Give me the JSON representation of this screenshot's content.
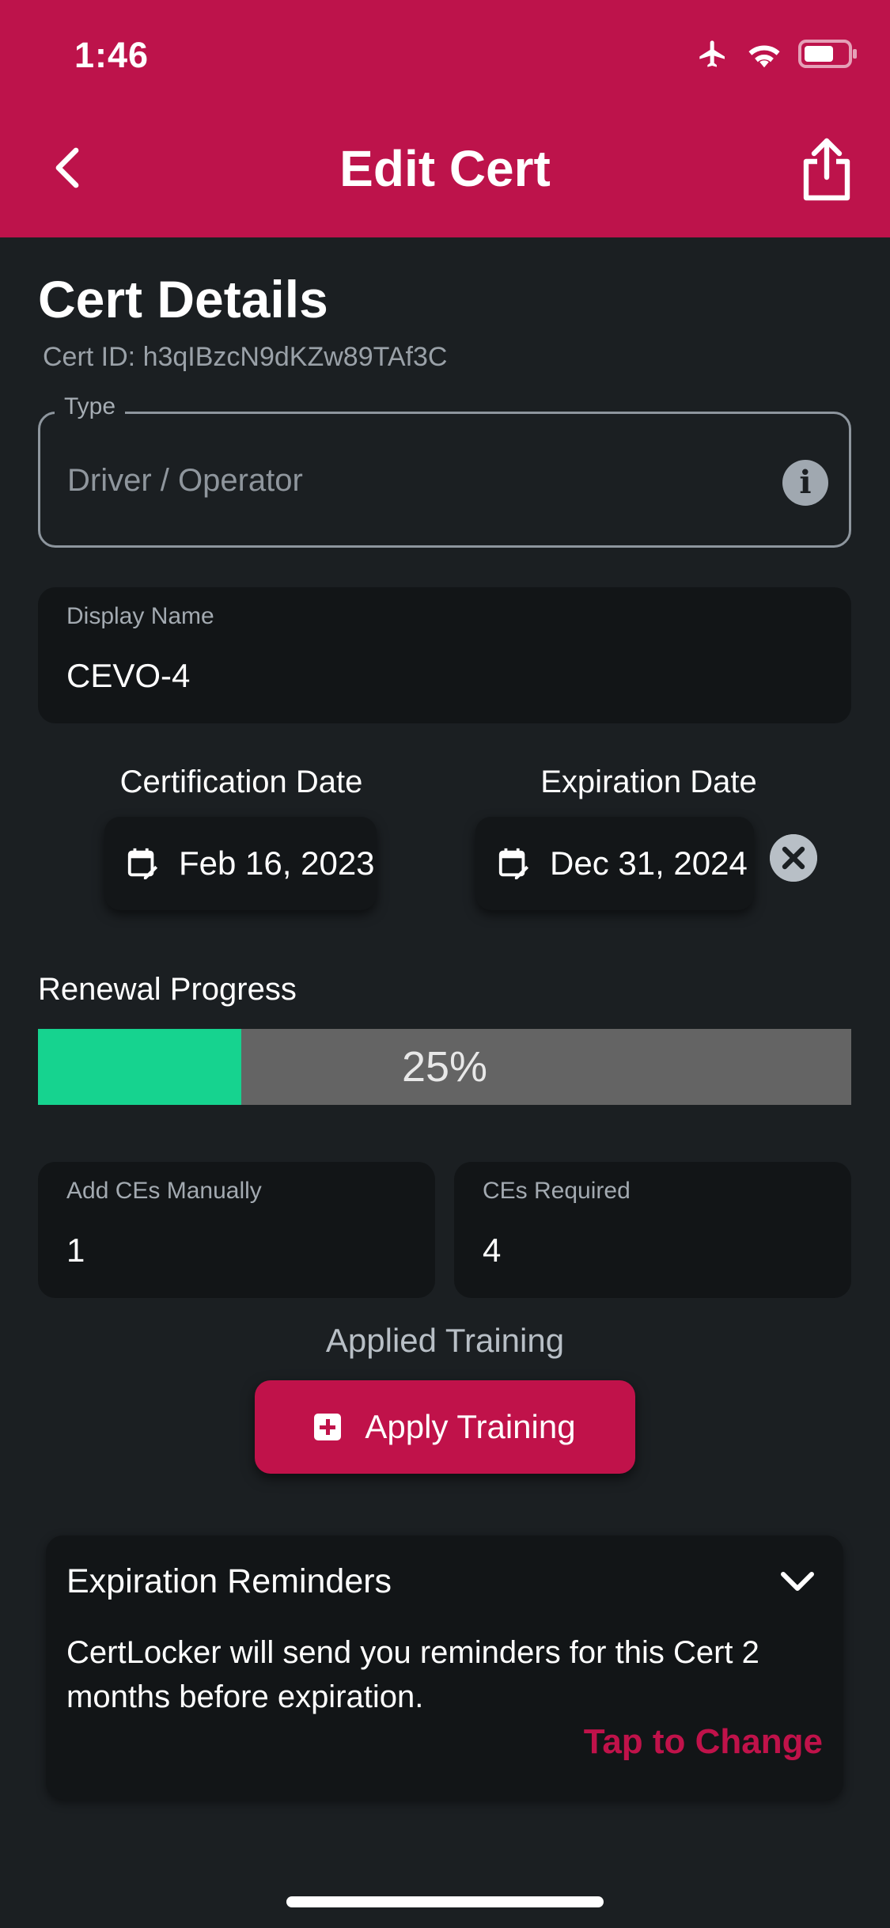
{
  "status_bar": {
    "time": "1:46",
    "icons": [
      "airplane-icon",
      "wifi-icon",
      "battery-icon"
    ]
  },
  "nav": {
    "title": "Edit Cert",
    "back_icon": "chevron-left-icon",
    "share_icon": "share-icon"
  },
  "details": {
    "title": "Cert Details",
    "cert_id": "Cert ID: h3qIBzcN9dKZw89TAf3C"
  },
  "type_field": {
    "label": "Type",
    "placeholder": "Driver / Operator"
  },
  "display_name": {
    "label": "Display Name",
    "value": "CEVO-4"
  },
  "dates": {
    "certification_label": "Certification Date",
    "certification_value": "Feb 16, 2023",
    "expiration_label": "Expiration Date",
    "expiration_value": "Dec 31, 2024"
  },
  "progress": {
    "label": "Renewal Progress",
    "percent_text": "25%",
    "fraction": 0.25
  },
  "ces": {
    "manual_label": "Add CEs Manually",
    "manual_value": "1",
    "required_label": "CEs Required",
    "required_value": "4"
  },
  "training": {
    "title": "Applied Training",
    "button_label": "Apply Training"
  },
  "reminders": {
    "title": "Expiration Reminders",
    "body": "CertLocker will send you reminders for this Cert 2 months before expiration.",
    "link": "Tap to Change"
  },
  "colors": {
    "brand": "#bd134b",
    "background": "#1b1f22",
    "progress_fill": "#16d38f",
    "progress_track": "#646464"
  }
}
